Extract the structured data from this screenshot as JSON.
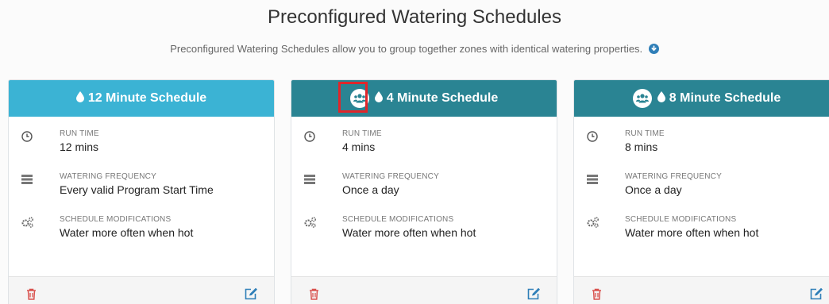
{
  "page": {
    "title": "Preconfigured Watering Schedules",
    "subtitle": "Preconfigured Watering Schedules allow you to group together zones with identical watering properties."
  },
  "colors": {
    "header_light": "#3bb3d4",
    "header_dark": "#2a8493",
    "highlight": "#e0262b",
    "delete": "#d9534f",
    "edit": "#2f7fb8"
  },
  "labels": {
    "run_time": "RUN TIME",
    "watering_frequency": "WATERING FREQUENCY",
    "schedule_modifications": "SCHEDULE MODIFICATIONS"
  },
  "cards": [
    {
      "title": "12 Minute Schedule",
      "run_time": "12 mins",
      "frequency": "Every valid Program Start Time",
      "modifications": "Water more often when hot",
      "has_group_icon": false
    },
    {
      "title": "4 Minute Schedule",
      "run_time": "4 mins",
      "frequency": "Once a day",
      "modifications": "Water more often when hot",
      "has_group_icon": true,
      "group_icon_highlighted": true
    },
    {
      "title": "8 Minute Schedule",
      "run_time": "8 mins",
      "frequency": "Once a day",
      "modifications": "Water more often when hot",
      "has_group_icon": true
    }
  ],
  "icons": {
    "drop": "water-drop-icon",
    "group": "group-icon",
    "clock": "clock-icon",
    "frequency": "server-stack-icon",
    "modifications": "gears-icon",
    "delete": "trash-icon",
    "edit": "edit-icon",
    "info": "info-circle-icon"
  }
}
